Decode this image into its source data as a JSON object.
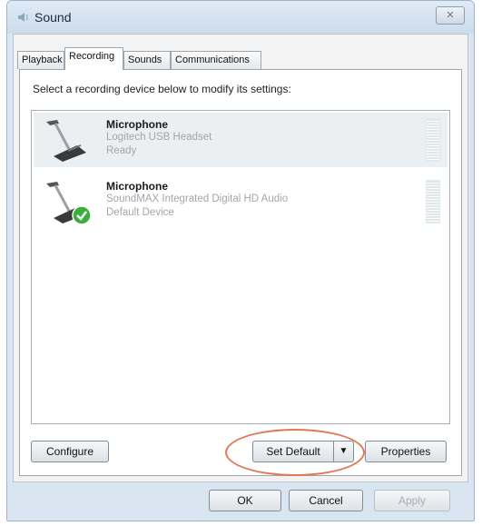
{
  "window": {
    "title": "Sound",
    "close_label": "✕"
  },
  "tabs": [
    {
      "label": "Playback",
      "active": false
    },
    {
      "label": "Recording",
      "active": true
    },
    {
      "label": "Sounds",
      "active": false
    },
    {
      "label": "Communications",
      "active": false
    }
  ],
  "recording": {
    "instruction": "Select a recording device below to modify its settings:",
    "devices": [
      {
        "name": "Microphone",
        "description": "Logitech USB Headset",
        "status": "Ready",
        "selected": true,
        "is_default": false
      },
      {
        "name": "Microphone",
        "description": "SoundMAX Integrated Digital HD Audio",
        "status": "Default Device",
        "selected": false,
        "is_default": true
      }
    ]
  },
  "buttons": {
    "configure": "Configure",
    "set_default": "Set Default",
    "set_default_arrow": "▼",
    "properties": "Properties",
    "ok": "OK",
    "cancel": "Cancel",
    "apply": "Apply"
  },
  "colors": {
    "highlight": "#e07a55",
    "default_check": "#3cae3c"
  }
}
